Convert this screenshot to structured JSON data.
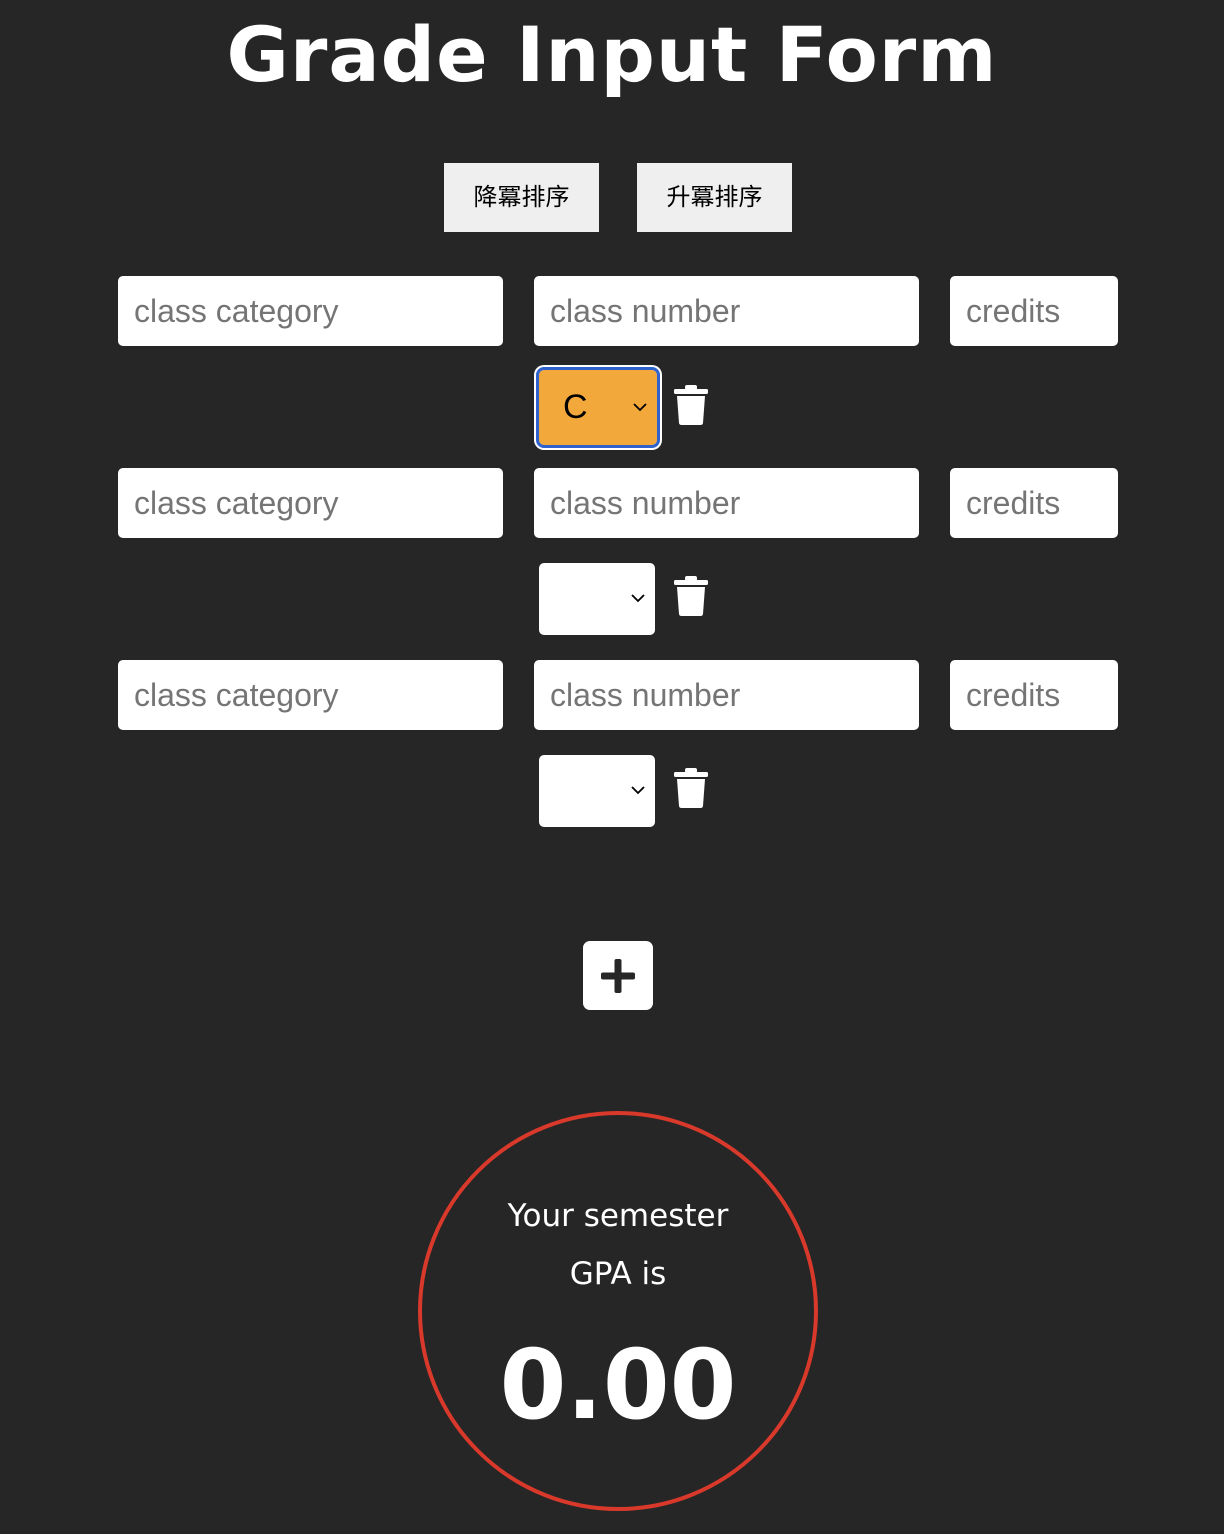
{
  "title": "Grade Input Form",
  "sort": {
    "descending_label": "降冪排序",
    "ascending_label": "升冪排序"
  },
  "rows": [
    {
      "category_placeholder": "class category",
      "number_placeholder": "class number",
      "credits_placeholder": "credits",
      "grade": "C",
      "grade_selected_color": "#f3a83c"
    },
    {
      "category_placeholder": "class category",
      "number_placeholder": "class number",
      "credits_placeholder": "credits",
      "grade": ""
    },
    {
      "category_placeholder": "class category",
      "number_placeholder": "class number",
      "credits_placeholder": "credits",
      "grade": ""
    }
  ],
  "icons": {
    "delete": "trash-icon",
    "add": "plus-icon",
    "dropdown": "chevron-down-icon"
  },
  "gpa": {
    "label_line1": "Your semester",
    "label_line2": "GPA is",
    "value": "0.00",
    "ring_color": "#d8392b"
  },
  "colors": {
    "background": "#262626",
    "focus_outline": "#2f62cc"
  }
}
